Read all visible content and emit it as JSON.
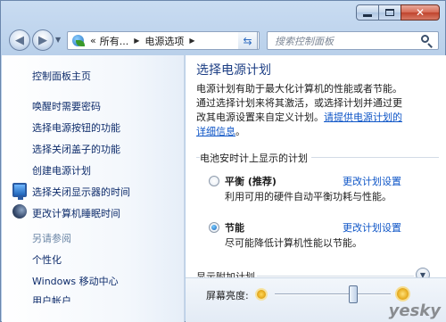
{
  "window": {
    "minimize_icon": "minimize-icon",
    "maximize_icon": "maximize-icon",
    "close_icon": "close-icon"
  },
  "navigation": {
    "breadcrumb_prefix": "«",
    "breadcrumbs": [
      "所有...",
      "电源选项"
    ],
    "search_placeholder": "搜索控制面板"
  },
  "sidebar": {
    "home": "控制面板主页",
    "items": [
      "唤醒时需要密码",
      "选择电源按钮的功能",
      "选择关闭盖子的功能",
      "创建电源计划",
      "选择关闭显示器的时间",
      "更改计算机睡眠时间"
    ],
    "see_also_title": "另请参阅",
    "see_also_items": [
      "个性化",
      "Windows 移动中心",
      "用户帐户"
    ]
  },
  "main": {
    "title": "选择电源计划",
    "description_lines": [
      "电源计划有助于最大化计算机的性能或者节能。",
      "通过选择计划来将其激活，或选择计划并通过更",
      "改其电源设置来自定义计划。"
    ],
    "description_link_1": "请提供电源计划的",
    "description_link_2": "详细信息",
    "description_end": "。",
    "plans_group_title": "电池安时计上显示的计划",
    "plans": [
      {
        "name": "平衡 (推荐)",
        "link": "更改计划设置",
        "desc": "利用可用的硬件自动平衡功耗与性能。",
        "selected": false
      },
      {
        "name": "节能",
        "link": "更改计划设置",
        "desc": "尽可能降低计算机性能以节能。",
        "selected": true
      }
    ],
    "extra_plans_title": "显示附加计划"
  },
  "brightness": {
    "label": "屏幕亮度:",
    "level_percent": 68
  },
  "watermark": "yesky"
}
